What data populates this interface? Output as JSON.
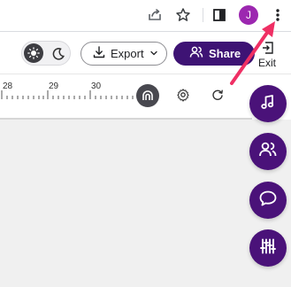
{
  "browser": {
    "avatar_letter": "J",
    "icons": [
      "share-page-icon",
      "star-icon",
      "side-panel-icon",
      "more-vert-icon"
    ]
  },
  "header": {
    "export_label": "Export",
    "share_label": "Share",
    "exit_label": "Exit"
  },
  "ruler": {
    "labels": [
      "28",
      "29",
      "30"
    ]
  },
  "fabs": [
    "music-note-icon",
    "collaborators-icon",
    "comment-icon",
    "mixer-sliders-icon"
  ],
  "colors": {
    "brand_purple": "#3e1374",
    "fab_purple": "#4a1279",
    "annotation_pink": "#ef2f64",
    "avatar_purple": "#9c27b0"
  }
}
